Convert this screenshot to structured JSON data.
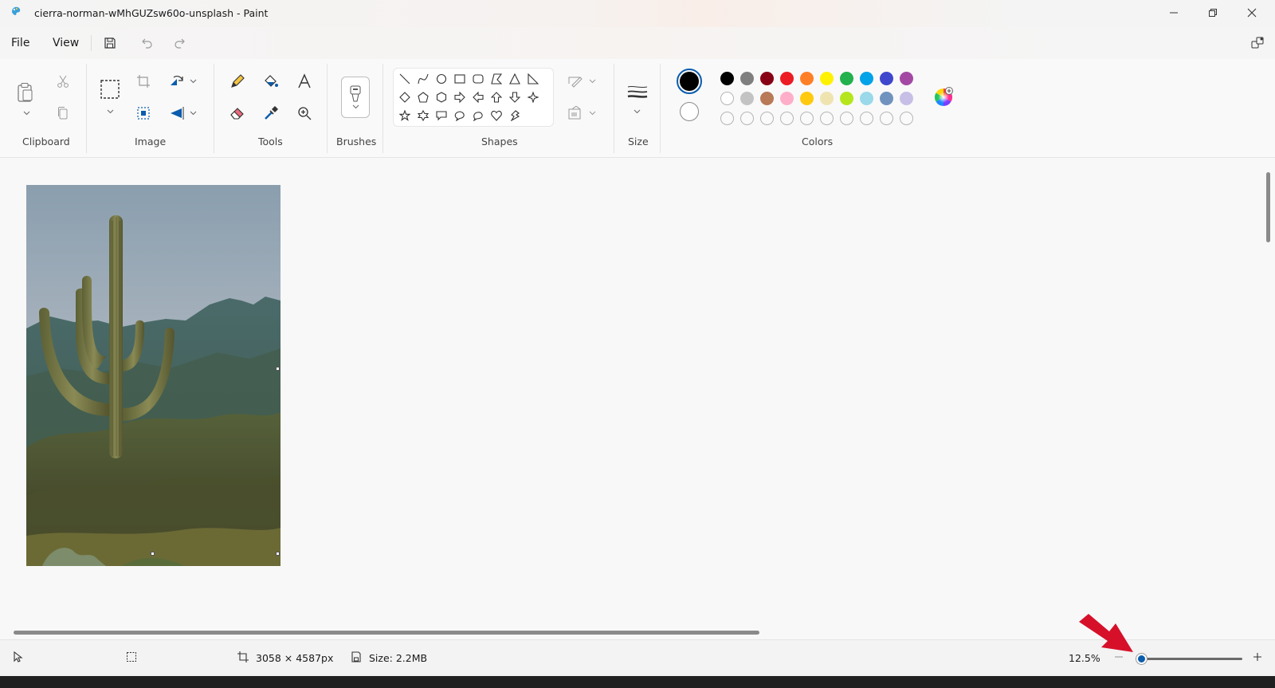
{
  "window": {
    "title": "cierra-norman-wMhGUZsw60o-unsplash - Paint",
    "app_icon": "paint-icon",
    "controls": [
      "minimize-icon",
      "restore-icon",
      "close-icon"
    ]
  },
  "menu": {
    "items": [
      {
        "label": "File"
      },
      {
        "label": "View"
      }
    ],
    "icons": [
      "save-icon",
      "undo-icon",
      "redo-icon",
      "layers-icon"
    ]
  },
  "ribbon": {
    "groups": {
      "clipboard": "Clipboard",
      "image": "Image",
      "tools": "Tools",
      "brushes": "Brushes",
      "shapes": "Shapes",
      "size": "Size",
      "colors": "Colors"
    },
    "primary_color": "#000000",
    "secondary_color": "#ffffff",
    "palette_row1": [
      "#000000",
      "#7f7f7f",
      "#880015",
      "#ed1c24",
      "#ff7f27",
      "#fff200",
      "#22b14c",
      "#00a2e8",
      "#3f48cc",
      "#a349a4"
    ],
    "palette_row2": [
      "#ffffff",
      "#c3c3c3",
      "#b97a57",
      "#ffaec9",
      "#ffc90e",
      "#efe4b0",
      "#b5e61d",
      "#99d9ea",
      "#7092be",
      "#c8bfe7"
    ],
    "palette_row3_count": 10
  },
  "canvas": {
    "image_description": "Saguaro cactus in front of desert mountains under overcast sky"
  },
  "status": {
    "dimensions": "3058 × 4587px",
    "size": "Size: 2.2MB",
    "zoom": "12.5%",
    "zoom_level": 0.0
  },
  "annotation": {
    "arrow_color": "#d7102a"
  }
}
